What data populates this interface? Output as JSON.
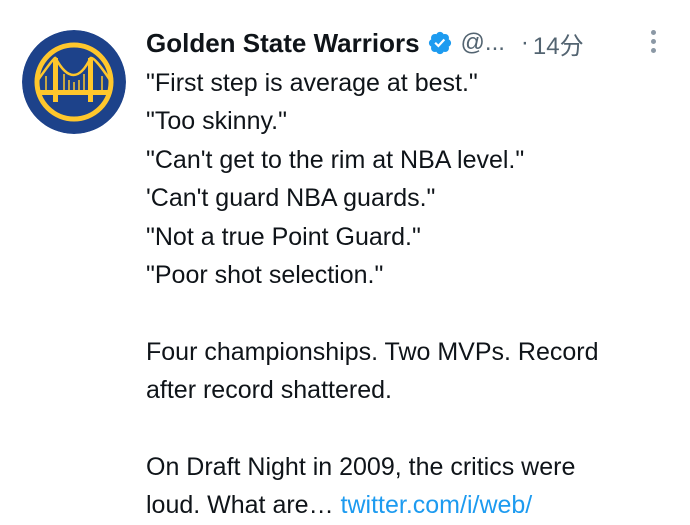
{
  "tweet": {
    "author": {
      "display_name": "Golden State Warriors",
      "handle": "@...",
      "verified_icon": "verified-badge-icon",
      "avatar_icon": "golden-gate-bridge-logo"
    },
    "separator": "·",
    "time": "14分",
    "more_icon": "more-options-icon",
    "quotes": [
      "\"First step is average at best.\"",
      "\"Too skinny.\"",
      "\"Can't get to the rim at NBA level.\"",
      "'Can't guard NBA guards.\"",
      "\"Not a true Point Guard.\"",
      "\"Poor shot selection.\""
    ],
    "paragraph2": [
      "Four championships. Two MVPs. Record",
      "after record shattered."
    ],
    "paragraph3_line1": "On Draft Night in 2009, the critics were",
    "paragraph3_line2_text": "loud. What are… ",
    "link_text": "twitter.com/i/web/"
  },
  "colors": {
    "text": "#0f1419",
    "secondary": "#536471",
    "link": "#1d9bf0",
    "verified": "#1d9bf0",
    "avatar_bg": "#1d428a",
    "avatar_gold": "#ffc72c"
  }
}
